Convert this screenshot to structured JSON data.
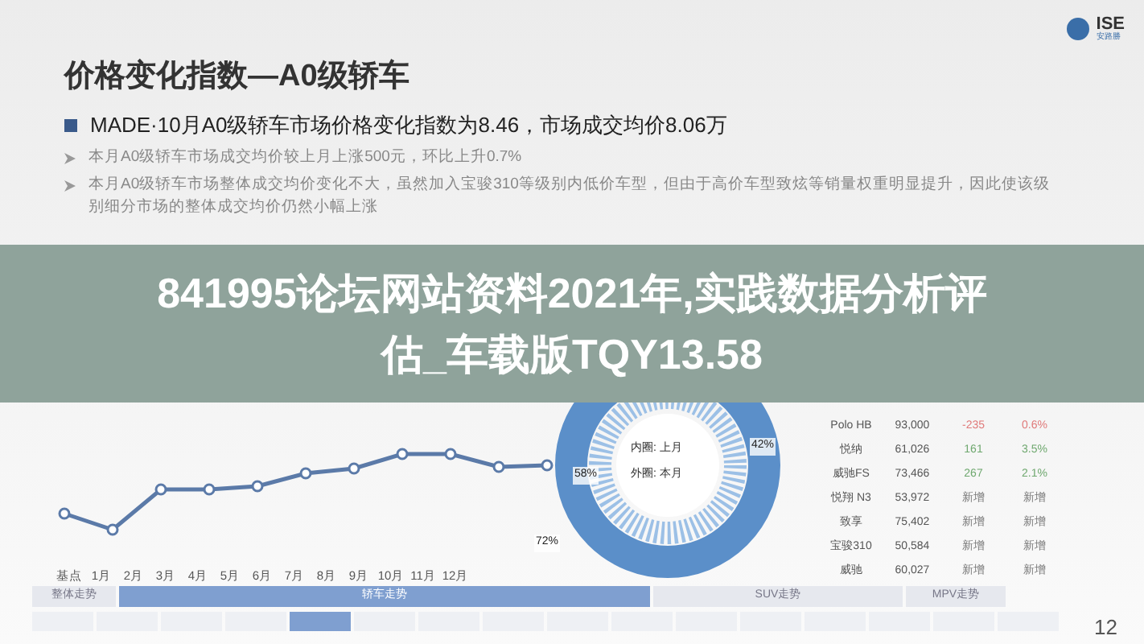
{
  "logo": {
    "text": "ISE",
    "subtext": "安路勝"
  },
  "title": "价格变化指数—A0级轿车",
  "headline": "MADE·10月A0级轿车市场价格变化指数为8.46，市场成交均价8.06万",
  "notes": [
    "本月A0级轿车市场成交均价较上月上涨500元，环比上升0.7%",
    "本月A0级轿车市场整体成交均价变化不大，虽然加入宝骏310等级别内低价车型，但由于高价车型致炫等销量权重明显提升，因此使该级别细分市场的整体成交均价仍然小幅上涨"
  ],
  "banner": {
    "lines": [
      "841995论坛网站资料2021年,实践数据分析评",
      "估_车载版TQY13.58"
    ]
  },
  "line_chart": {
    "months": [
      "基点",
      "1月",
      "2月",
      "3月",
      "4月",
      "5月",
      "6月",
      "7月",
      "8月",
      "9月",
      "10月",
      "11月",
      "12月"
    ]
  },
  "donut": {
    "inner_label": "内圈: 上月",
    "outer_label": "外圈: 本月",
    "labels": [
      "42%",
      "58%",
      "72%"
    ]
  },
  "table": {
    "rows": [
      {
        "cells": [
          "Polo HB",
          "93,000",
          "-235",
          "0.6%"
        ],
        "color": "#e07a7a"
      },
      {
        "cells": [
          "悦纳",
          "61,026",
          "161",
          "3.5%"
        ],
        "color": "#6fa86f"
      },
      {
        "cells": [
          "威驰FS",
          "73,466",
          "267",
          "2.1%"
        ],
        "color": "#6fa86f"
      },
      {
        "cells": [
          "悦翔 N3",
          "53,972",
          "新增",
          "新增"
        ],
        "color": "#777777"
      },
      {
        "cells": [
          "致享",
          "75,402",
          "新增",
          "新增"
        ],
        "color": "#777777"
      },
      {
        "cells": [
          "宝骏310",
          "50,584",
          "新增",
          "新增"
        ],
        "color": "#777777"
      },
      {
        "cells": [
          "威驰",
          "60,027",
          "新增",
          "新增"
        ],
        "color": "#777777"
      }
    ]
  },
  "nav_tabs": [
    {
      "label": "整体走势",
      "selected": false
    },
    {
      "label": "轿车走势",
      "selected": true
    },
    {
      "label": "SUV走势",
      "selected": false
    },
    {
      "label": "MPV走势",
      "selected": false
    }
  ],
  "sub_tabs": [
    {
      "selected": false
    },
    {
      "selected": false
    },
    {
      "selected": false
    },
    {
      "selected": false
    },
    {
      "selected": true
    },
    {
      "selected": false
    },
    {
      "selected": false
    },
    {
      "selected": false
    },
    {
      "selected": false
    },
    {
      "selected": false
    },
    {
      "selected": false
    },
    {
      "selected": false
    },
    {
      "selected": false
    },
    {
      "selected": false
    },
    {
      "selected": false
    },
    {
      "selected": false
    }
  ],
  "page_number": "12"
}
